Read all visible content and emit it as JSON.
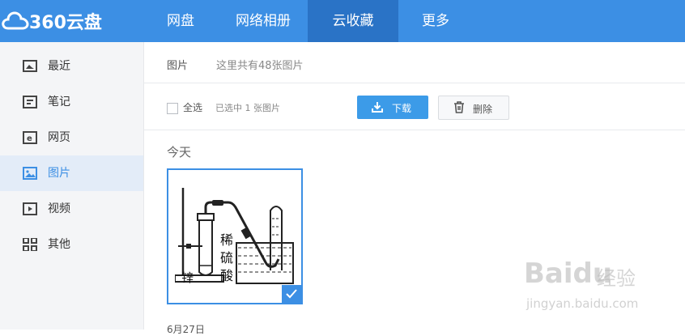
{
  "brand": {
    "logo_text": "360云盘",
    "icon": "cloud-icon"
  },
  "nav": {
    "tabs": [
      {
        "label": "网盘"
      },
      {
        "label": "网络相册"
      },
      {
        "label": "云收藏",
        "active": true
      },
      {
        "label": "更多"
      }
    ]
  },
  "sidebar": {
    "items": [
      {
        "label": "最近",
        "icon": "recent-icon"
      },
      {
        "label": "笔记",
        "icon": "note-icon"
      },
      {
        "label": "网页",
        "icon": "webpage-icon"
      },
      {
        "label": "图片",
        "icon": "image-icon",
        "active": true
      },
      {
        "label": "视频",
        "icon": "video-icon"
      },
      {
        "label": "其他",
        "icon": "grid-icon"
      }
    ]
  },
  "main": {
    "breadcrumb": "图片",
    "count_text": "这里共有48张图片",
    "select_all_label": "全选",
    "selection_info": "已选中 1 张图片",
    "download_label": "下载",
    "delete_label": "删除",
    "group_today": "今天",
    "group_next": "6月27日",
    "thumbnail": {
      "labels": [
        "稀",
        "硫",
        "酸",
        "锌"
      ],
      "selected": true
    }
  },
  "watermark": {
    "logo": "Baidu",
    "cn": "经验",
    "url": "jingyan.baidu.com"
  },
  "colors": {
    "accent": "#3c8fe4",
    "topbar": "#3c8fe4",
    "active_tab": "#2a73c6"
  }
}
